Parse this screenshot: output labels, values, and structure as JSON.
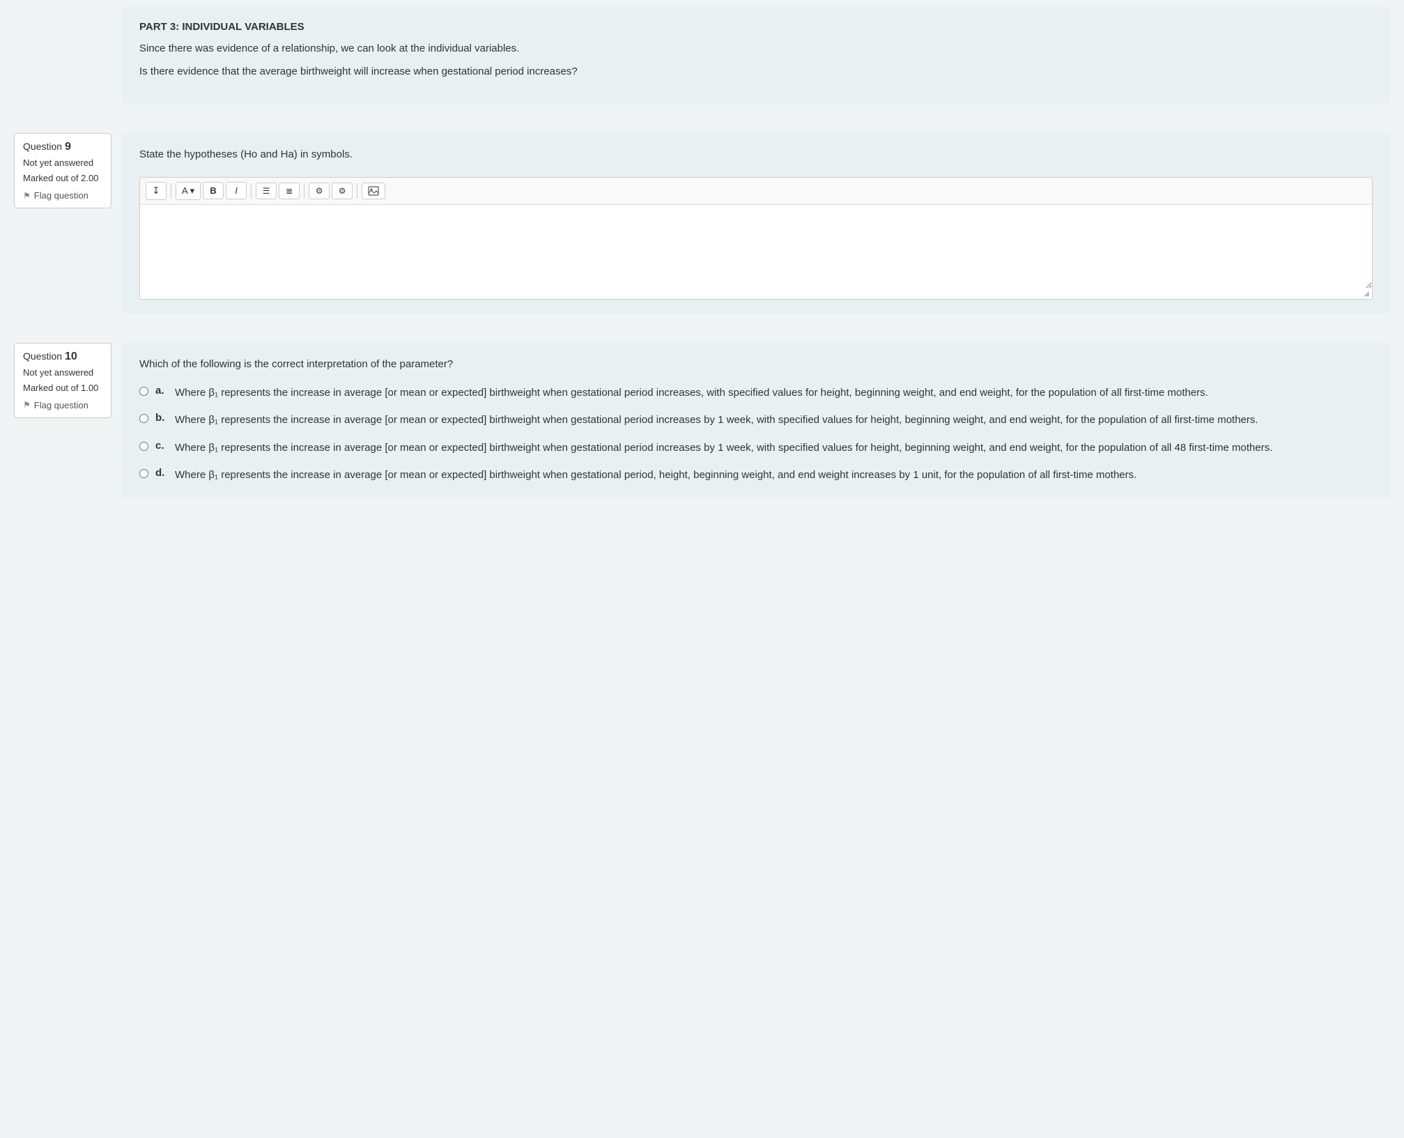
{
  "part3": {
    "title": "PART 3: INDIVIDUAL VARIABLES",
    "text1": "Since there was evidence of a relationship, we can look at the individual variables.",
    "text2": "Is there evidence that the average birthweight will increase when gestational period increases?"
  },
  "question9": {
    "number_label": "Question",
    "number": "9",
    "status": "Not yet answered",
    "marked": "Marked out of 2.00",
    "flag_label": "Flag question",
    "question_text": "State the hypotheses (Ho and Ha) in symbols.",
    "toolbar": {
      "undo": "↧",
      "font": "A",
      "bold": "B",
      "italic": "I",
      "unordered_list": "≡",
      "ordered_list": "≣",
      "link": "⚬",
      "unlink": "⚬",
      "image": "🖼"
    }
  },
  "question10": {
    "number_label": "Question",
    "number": "10",
    "status": "Not yet answered",
    "marked": "Marked out of 1.00",
    "flag_label": "Flag question",
    "question_text": "Which of the following is the correct interpretation of the parameter?",
    "options": [
      {
        "letter": "a.",
        "text": "Where β₁ represents the increase in average [or mean or expected] birthweight when gestational period increases, with specified values for height, beginning weight, and end weight, for the population of all first-time mothers."
      },
      {
        "letter": "b.",
        "text": "Where β₁ represents the increase in average [or mean or expected] birthweight when gestational period increases by 1 week, with specified values for height, beginning weight, and end weight, for the population of all first-time mothers."
      },
      {
        "letter": "c.",
        "text": "Where β₁ represents the increase in average [or mean or expected] birthweight when gestational period increases by 1 week, with specified values for height, beginning weight, and end weight, for the population of all 48 first-time mothers."
      },
      {
        "letter": "d.",
        "text": "Where β₁ represents the increase in average [or mean or expected] birthweight when gestational period, height, beginning weight, and end weight increases by 1 unit, for the population of all first-time mothers."
      }
    ]
  }
}
